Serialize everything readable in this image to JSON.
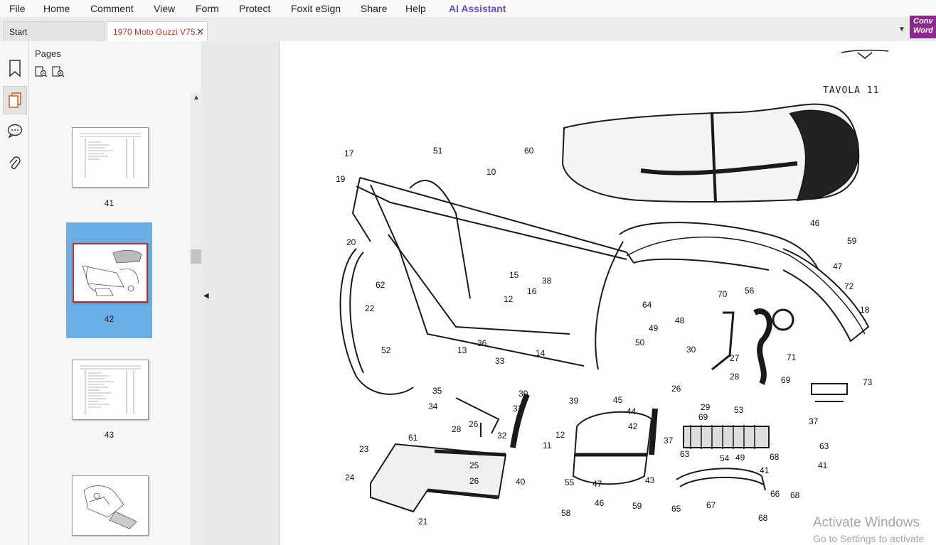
{
  "menu": {
    "items": [
      "File",
      "Home",
      "Comment",
      "View",
      "Form",
      "Protect",
      "Foxit eSign",
      "Share",
      "Help"
    ],
    "ai_assistant": "AI Assistant"
  },
  "tabs": {
    "start": "Start",
    "document": "1970 Moto Guzzi V75..."
  },
  "convert_button": [
    "Conv",
    "Word"
  ],
  "sidebar": {
    "icons": [
      "bookmark-icon",
      "pages-icon",
      "comment-icon",
      "attachment-icon"
    ]
  },
  "pages_panel": {
    "title": "Pages",
    "thumbnails": [
      {
        "label": "41",
        "selected": false
      },
      {
        "label": "42",
        "selected": true
      },
      {
        "label": "43",
        "selected": false
      },
      {
        "label": "",
        "selected": false
      }
    ]
  },
  "document": {
    "plate_title": "TAVOLA 11",
    "part_numbers": [
      "17",
      "19",
      "20",
      "51",
      "10",
      "60",
      "46",
      "59",
      "47",
      "72",
      "18",
      "62",
      "22",
      "15",
      "16",
      "38",
      "12",
      "64",
      "70",
      "56",
      "49",
      "48",
      "50",
      "30",
      "27",
      "28",
      "71",
      "52",
      "13",
      "36",
      "14",
      "33",
      "35",
      "34",
      "28",
      "26",
      "30",
      "31",
      "39",
      "32",
      "12",
      "11",
      "61",
      "23",
      "24",
      "25",
      "26",
      "40",
      "21",
      "55",
      "47",
      "46",
      "58",
      "59",
      "43",
      "44",
      "42",
      "45",
      "26",
      "69",
      "29",
      "53",
      "37",
      "63",
      "54",
      "49",
      "68",
      "41",
      "66",
      "65",
      "67",
      "68",
      "73",
      "69",
      "37",
      "63",
      "41",
      "68"
    ]
  },
  "watermark": {
    "line1": "Activate Windows",
    "line2": "Go to Settings to activate"
  }
}
